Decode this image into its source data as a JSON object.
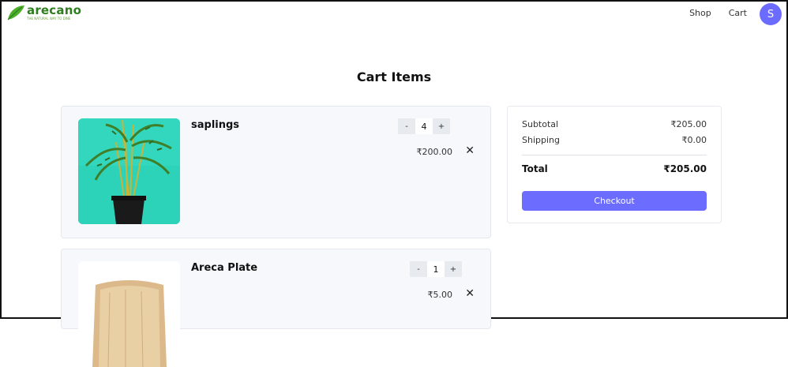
{
  "brand": {
    "name": "arecano",
    "tagline": "THE NATURAL WAY TO DINE"
  },
  "nav": {
    "shop": "Shop",
    "cart": "Cart",
    "avatar_initial": "S"
  },
  "page_title": "Cart Items",
  "cart_items": [
    {
      "name": "saplings",
      "quantity": "4",
      "decrement": "-",
      "increment": "+",
      "price": "₹200.00",
      "remove": "✕"
    },
    {
      "name": "Areca Plate",
      "quantity": "1",
      "decrement": "-",
      "increment": "+",
      "price": "₹5.00",
      "remove": "✕"
    }
  ],
  "summary": {
    "subtotal_label": "Subtotal",
    "subtotal_value": "₹205.00",
    "shipping_label": "Shipping",
    "shipping_value": "₹0.00",
    "total_label": "Total",
    "total_value": "₹205.00",
    "checkout_label": "Checkout"
  },
  "colors": {
    "accent": "#6c6cff",
    "brand_green": "#2e7d1f",
    "card_bg": "#f6f8fb"
  }
}
